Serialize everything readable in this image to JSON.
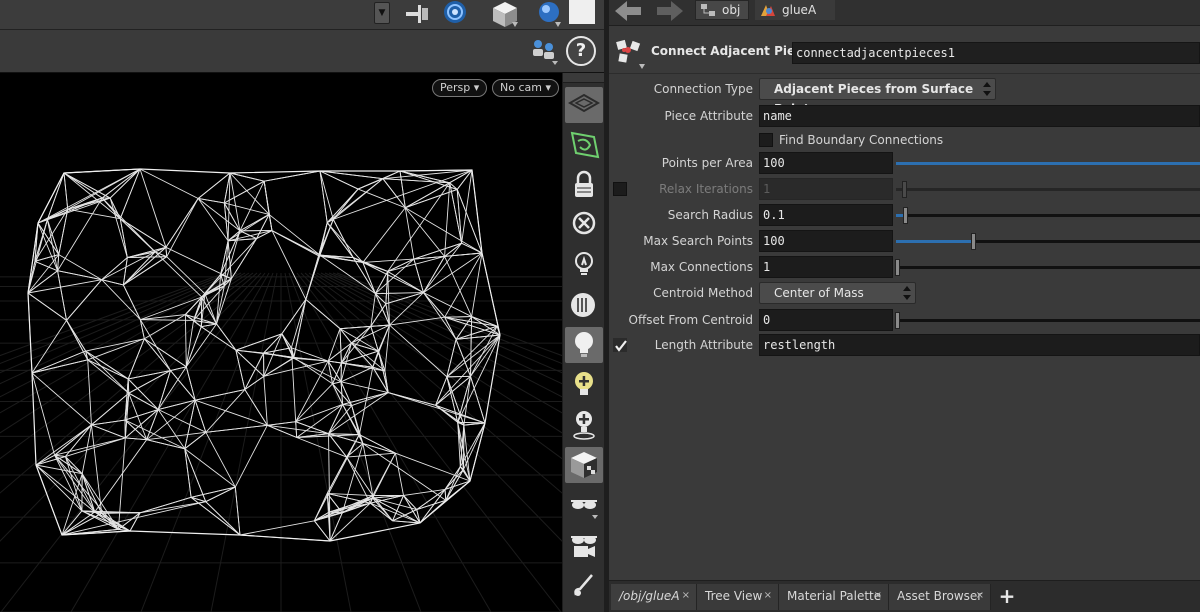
{
  "viewport": {
    "camera_chip": "Persp",
    "view_chip": "No cam"
  },
  "path_bar": {
    "crumbs": [
      "obj",
      "glueA"
    ]
  },
  "node": {
    "type_label": "Connect Adjacent Pieces",
    "name": "connectadjacentpieces1"
  },
  "params": {
    "connection_type": {
      "label": "Connection Type",
      "value": "Adjacent Pieces from Surface Points"
    },
    "piece_attribute": {
      "label": "Piece Attribute",
      "value": "name"
    },
    "find_boundary": {
      "label": "Find Boundary Connections",
      "checked": false
    },
    "points_per_area": {
      "label": "Points per Area",
      "value": "100"
    },
    "relax_iterations": {
      "label": "Relax Iterations",
      "value": "1",
      "enabled": false
    },
    "search_radius": {
      "label": "Search Radius",
      "value": "0.1"
    },
    "max_search_points": {
      "label": "Max Search Points",
      "value": "100"
    },
    "max_connections": {
      "label": "Max Connections",
      "value": "1"
    },
    "centroid_method": {
      "label": "Centroid Method",
      "value": "Center of Mass"
    },
    "offset_from_centroid": {
      "label": "Offset From Centroid",
      "value": "0"
    },
    "length_attribute": {
      "label": "Length Attribute",
      "value": "restlength",
      "enabled": true
    }
  },
  "pane_tabs": [
    {
      "label": "/obj/glueA",
      "close": "×"
    },
    {
      "label": "Tree View",
      "close": "×"
    },
    {
      "label": "Material Palette",
      "close": "×"
    },
    {
      "label": "Asset Browser",
      "close": "×"
    }
  ],
  "add_tab_label": "+",
  "help_label": "?",
  "icons": {
    "viewport_toolbar": [
      "pin-icon",
      "target-icon",
      "cube-icon",
      "sphere-icon",
      "blank-swatch-icon"
    ],
    "viewport_side": [
      "grid-plane-icon",
      "construction-plane-icon",
      "lock-icon",
      "close-circle-icon",
      "light-link-icon",
      "headlight-icon",
      "lightbulb-icon",
      "add-light-icon",
      "add-light-pin-icon",
      "shaded-cube-icon",
      "glasses-icon",
      "camera-glasses-icon",
      "dot-icon",
      "brush-icon"
    ]
  }
}
